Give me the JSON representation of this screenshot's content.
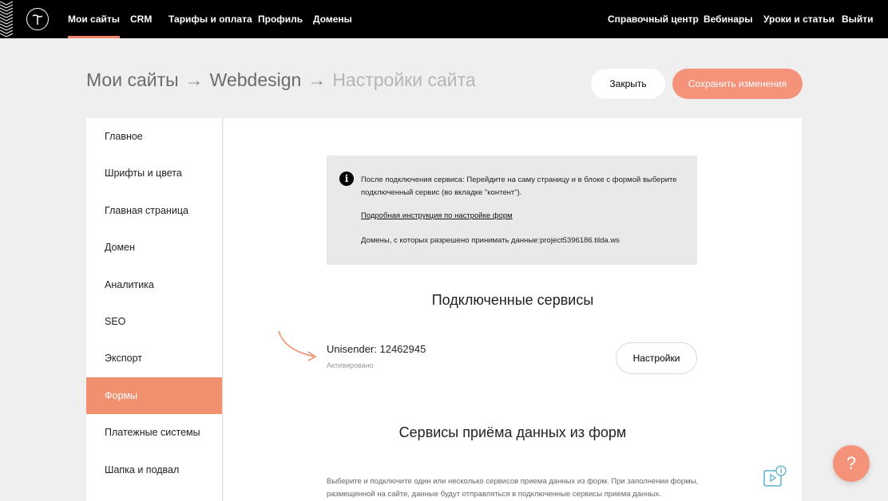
{
  "nav": {
    "items": [
      {
        "label": "Мои сайты",
        "active": true
      },
      {
        "label": "CRM"
      },
      {
        "label": "Тарифы и оплата"
      },
      {
        "label": "Профиль"
      },
      {
        "label": "Домены"
      }
    ],
    "right_items": [
      {
        "label": "Справочный центр"
      },
      {
        "label": "Вебинары"
      },
      {
        "label": "Уроки и статьи"
      },
      {
        "label": "Выйти"
      }
    ]
  },
  "breadcrumb": {
    "items": [
      "Мои сайты",
      "Webdesign",
      "Настройки сайта"
    ],
    "separator": "→"
  },
  "actions": {
    "close_label": "Закрыть",
    "save_label": "Сохранить изменения"
  },
  "sidebar": {
    "items": [
      {
        "label": "Главное"
      },
      {
        "label": "Шрифты и цвета"
      },
      {
        "label": "Главная страница"
      },
      {
        "label": "Домен"
      },
      {
        "label": "Аналитика"
      },
      {
        "label": "SEO"
      },
      {
        "label": "Экспорт"
      },
      {
        "label": "Формы",
        "active": true
      },
      {
        "label": "Платежные системы"
      },
      {
        "label": "Шапка и подвал"
      }
    ]
  },
  "info": {
    "text": "После подключения сервиса: Перейдите на саму страницу и в блоке с формой выберите подключенный сервис (во вкладке \"контент\").",
    "link": "Подробная инструкция по настройке форм",
    "domains": "Домены, с которых разрешено принимать данные:project5396186.tilda.ws"
  },
  "connected": {
    "heading": "Подключенные сервисы",
    "service_name": "Unisender: 12462945",
    "service_status": "Активировано",
    "settings_label": "Настройки"
  },
  "receive": {
    "heading": "Сервисы приёма данных из форм",
    "description": "Выберите и подключите один или несколько сервисов приема данных из форм. При заполнении формы, размещенной на сайте, данные будут отправляться в подключенные сервисы приема данных."
  },
  "help": {
    "label": "?"
  },
  "colors": {
    "accent": "#f4937a",
    "active_sidebar": "#f0906f",
    "topbar": "#000000",
    "background": "#efefef"
  },
  "icons": {
    "logo": "tilda-logo-icon",
    "info": "info-icon",
    "arrow": "curved-arrow-icon",
    "video": "video-help-icon"
  }
}
